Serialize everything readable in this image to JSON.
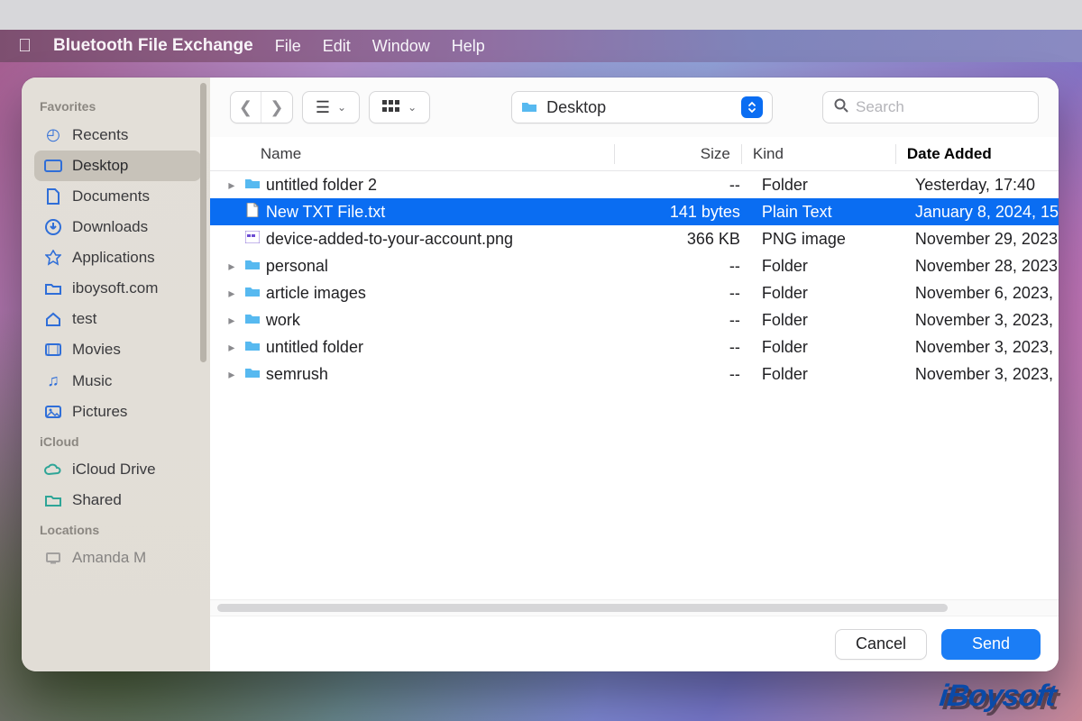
{
  "menubar": {
    "app_name": "Bluetooth File Exchange",
    "items": [
      "File",
      "Edit",
      "Window",
      "Help"
    ]
  },
  "sidebar": {
    "groups": [
      {
        "label": "Favorites",
        "items": [
          {
            "icon": "clock-icon",
            "label": "Recents"
          },
          {
            "icon": "desktop-icon",
            "label": "Desktop",
            "selected": true
          },
          {
            "icon": "document-icon",
            "label": "Documents"
          },
          {
            "icon": "download-icon",
            "label": "Downloads"
          },
          {
            "icon": "applications-icon",
            "label": "Applications"
          },
          {
            "icon": "folder-icon",
            "label": "iboysoft.com"
          },
          {
            "icon": "house-icon",
            "label": "test"
          },
          {
            "icon": "movies-icon",
            "label": "Movies"
          },
          {
            "icon": "music-icon",
            "label": "Music"
          },
          {
            "icon": "pictures-icon",
            "label": "Pictures"
          }
        ]
      },
      {
        "label": "iCloud",
        "items": [
          {
            "icon": "icloud-icon",
            "label": "iCloud Drive"
          },
          {
            "icon": "shared-icon",
            "label": "Shared"
          }
        ]
      },
      {
        "label": "Locations",
        "items": [
          {
            "icon": "mac-icon",
            "label": "Amanda M"
          }
        ]
      }
    ]
  },
  "toolbar": {
    "location": "Desktop",
    "search_placeholder": "Search"
  },
  "columns": {
    "name": "Name",
    "size": "Size",
    "kind": "Kind",
    "date": "Date Added"
  },
  "rows": [
    {
      "expandable": true,
      "icon": "folder",
      "name": "untitled folder 2",
      "size": "--",
      "kind": "Folder",
      "date": "Yesterday, 17:40"
    },
    {
      "expandable": false,
      "icon": "txt",
      "name": "New TXT File.txt",
      "size": "141 bytes",
      "kind": "Plain Text",
      "date": "January 8, 2024, 15",
      "selected": true
    },
    {
      "expandable": false,
      "icon": "png",
      "name": "device-added-to-your-account.png",
      "size": "366 KB",
      "kind": "PNG image",
      "date": "November 29, 2023"
    },
    {
      "expandable": true,
      "icon": "folder",
      "name": "personal",
      "size": "--",
      "kind": "Folder",
      "date": "November 28, 2023"
    },
    {
      "expandable": true,
      "icon": "folder",
      "name": "article images",
      "size": "--",
      "kind": "Folder",
      "date": "November 6, 2023,"
    },
    {
      "expandable": true,
      "icon": "folder",
      "name": "work",
      "size": "--",
      "kind": "Folder",
      "date": "November 3, 2023,"
    },
    {
      "expandable": true,
      "icon": "folder",
      "name": "untitled folder",
      "size": "--",
      "kind": "Folder",
      "date": "November 3, 2023,"
    },
    {
      "expandable": true,
      "icon": "folder",
      "name": "semrush",
      "size": "--",
      "kind": "Folder",
      "date": "November 3, 2023,"
    }
  ],
  "footer": {
    "cancel": "Cancel",
    "send": "Send"
  },
  "watermark": "iBoysoft"
}
